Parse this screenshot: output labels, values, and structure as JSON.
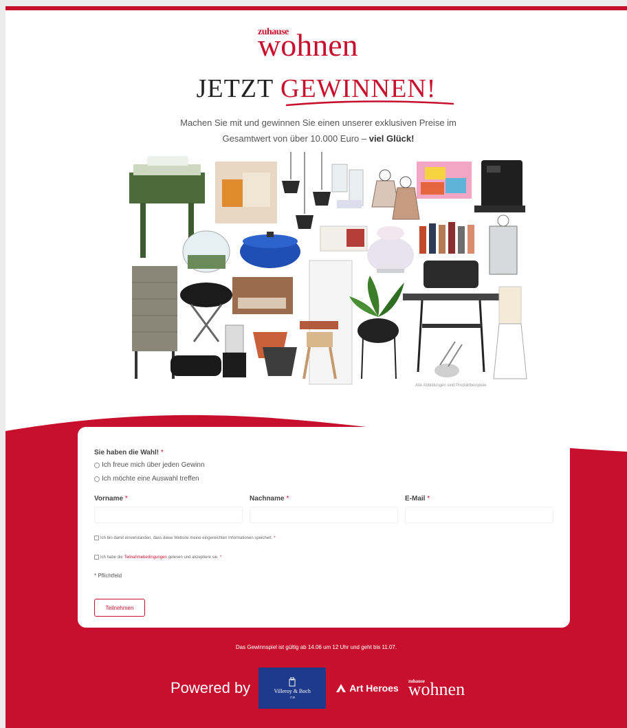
{
  "brand": {
    "logo_small": "zuhause",
    "logo_big": "wohnen"
  },
  "headline": {
    "part1": "JETZT ",
    "part2": "GEWINNEN!"
  },
  "intro": {
    "line1": "Machen Sie mit und gewinnen Sie einen unserer exklusiven Preise im",
    "line2_prefix": "Gesamtwert von über 10.000 Euro – ",
    "line2_bold": "viel Glück!"
  },
  "collage": {
    "caption": "Alle Abbildungen sind Produktbeispiele"
  },
  "form": {
    "choice_label": "Sie haben die Wahl!",
    "required_mark": "*",
    "options": [
      "Ich freue mich über jeden Gewinn",
      "Ich möchte eine Auswahl treffen"
    ],
    "fields": [
      {
        "label": "Vorname",
        "value": ""
      },
      {
        "label": "Nachname",
        "value": ""
      },
      {
        "label": "E-Mail",
        "value": ""
      }
    ],
    "consent1": "Ich bin damit einverstanden, dass diese Website meine eingereichten Informationen speichert.",
    "consent2_prefix": "Ich habe die ",
    "consent2_link": "Teilnahmebedingungen",
    "consent2_suffix": " gelesen und akzeptiere sie.",
    "required_note": "* Pflichtfeld",
    "submit_label": "Teilnehmen"
  },
  "footer": {
    "validity": "Das Gewinnspiel ist gültig ab 14.06 um 12 Uhr und geht bis 11.07.",
    "powered_by": "Powered by",
    "vb_name": "Villeroy & Boch",
    "vb_year": "1748",
    "art_heroes": "Art Heroes",
    "logo_small": "zuhause",
    "logo_big": "wohnen"
  },
  "colors": {
    "accent": "#c8102e",
    "vb_blue": "#1e3a8a"
  }
}
